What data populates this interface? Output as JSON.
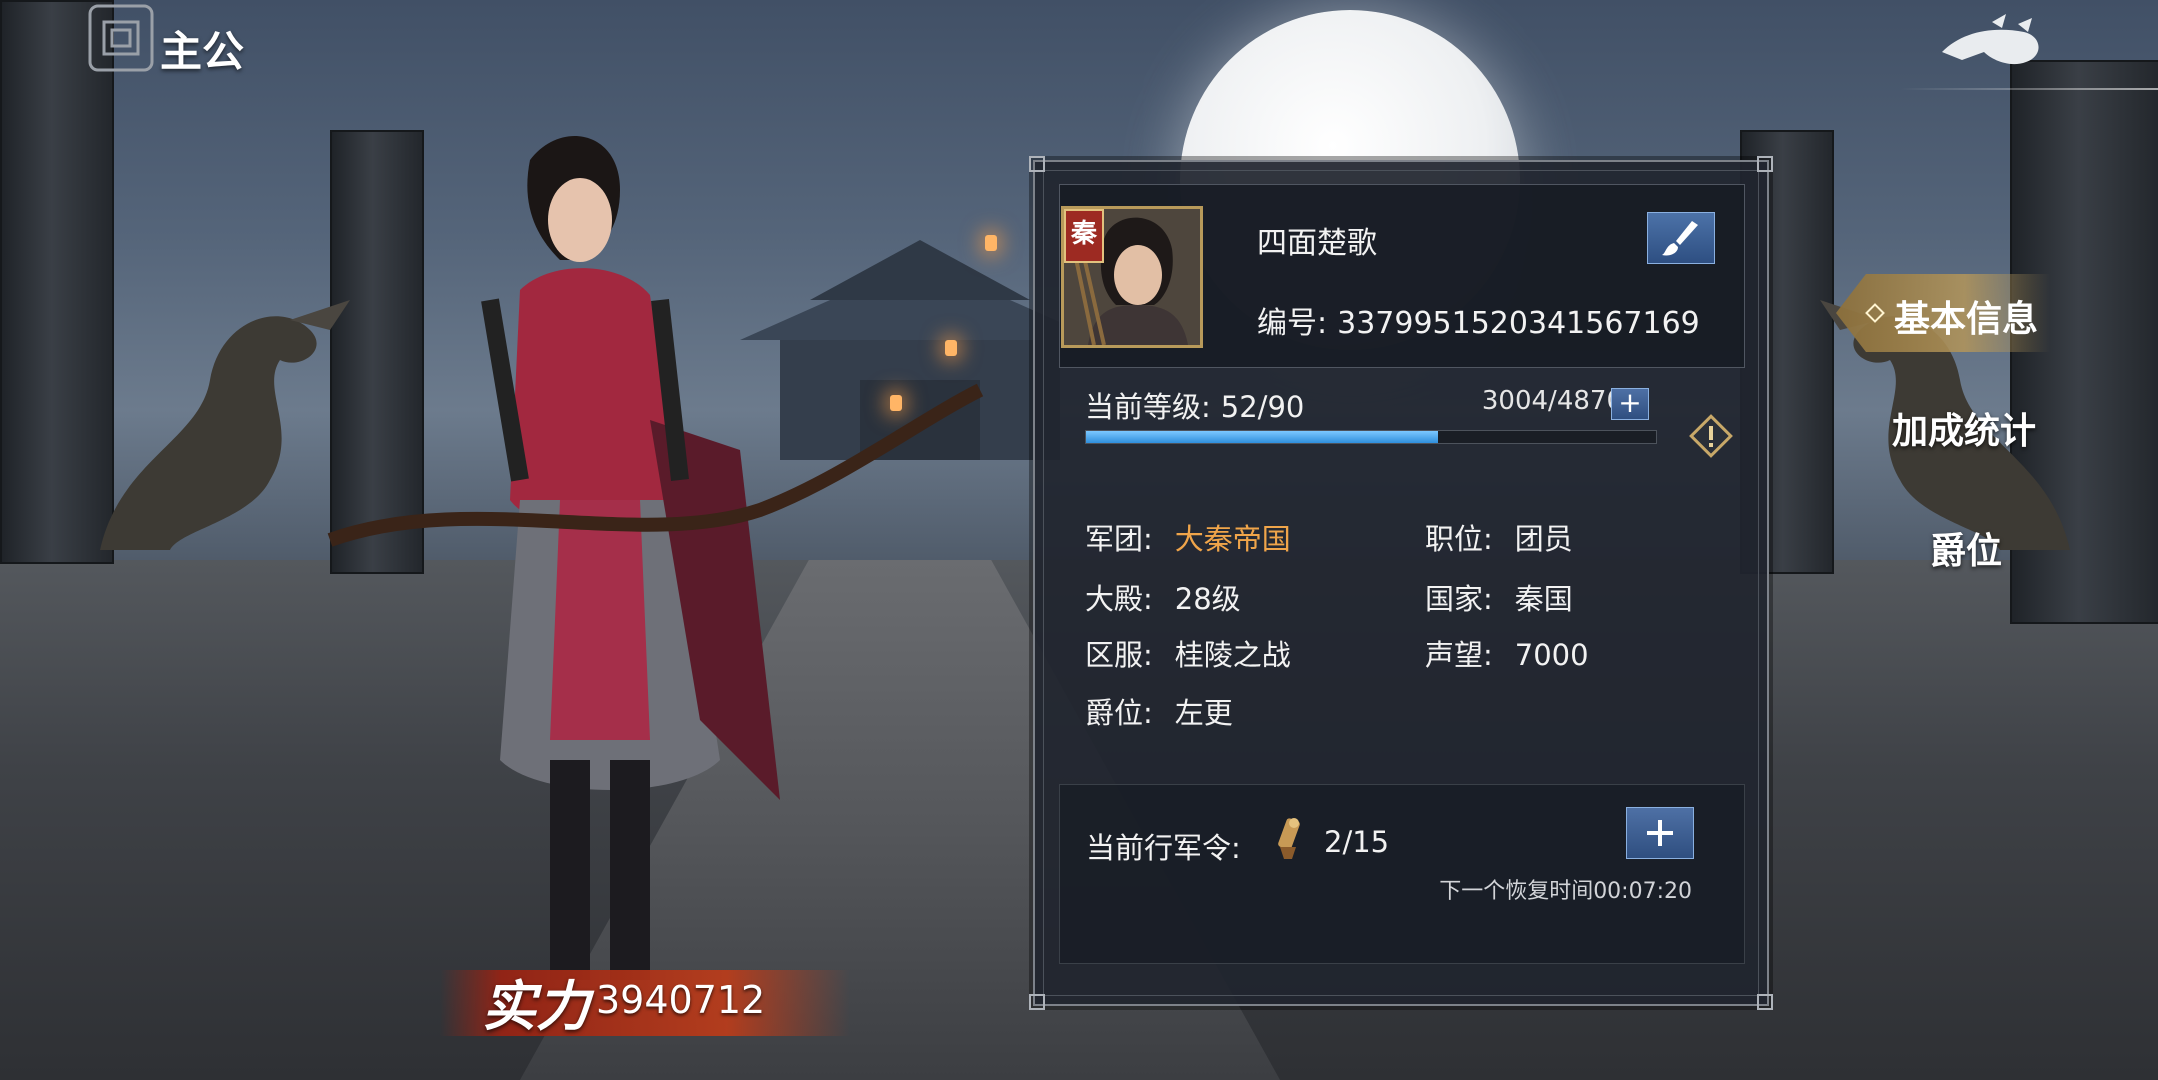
{
  "header": {
    "title": "主公",
    "back_icon": "dragon-back-icon"
  },
  "profile": {
    "name": "四面楚歌",
    "id_label": "编号:",
    "id_value": "3379951520341567169",
    "nation_badge": "秦",
    "edit_icon": "brush-icon"
  },
  "level": {
    "label": "当前等级:",
    "value": "52/90",
    "exp_text": "3004/4870",
    "exp_fraction": 0.617,
    "plus_label": "+"
  },
  "info": {
    "legion_label": "军团:",
    "legion_value": "大秦帝国",
    "position_label": "职位:",
    "position_value": "团员",
    "hall_label": "大殿:",
    "hall_value": "28级",
    "country_label": "国家:",
    "country_value": "秦国",
    "server_label": "区服:",
    "server_value": "桂陵之战",
    "prestige_label": "声望:",
    "prestige_value": "7000",
    "rank_label": "爵位:",
    "rank_value": "左更"
  },
  "march": {
    "label": "当前行军令:",
    "count": "2/15",
    "recover_text": "下一个恢复时间00:07:20",
    "icon": "march-order-icon"
  },
  "tabs": {
    "basic_info": "基本信息",
    "bonus_stats": "加成统计",
    "nobility": "爵位"
  },
  "power": {
    "label": "实力",
    "value": "3940712"
  },
  "colors": {
    "accent_orange": "#f0a54a",
    "exp_blue": "#2f8fdc",
    "button_blue": "#3a5f95"
  }
}
